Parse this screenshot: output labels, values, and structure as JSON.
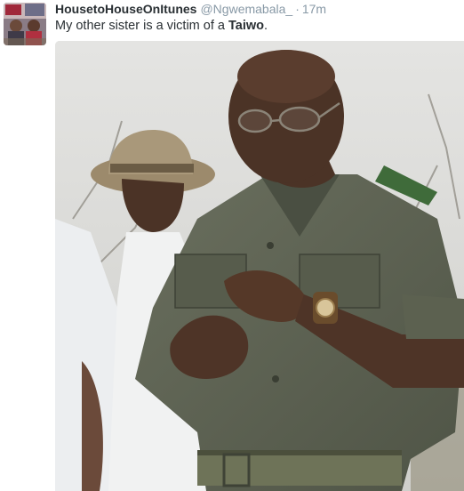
{
  "tweet": {
    "display_name": "HousetoHouseOnItunes",
    "handle": "@Ngwemabala_",
    "separator": "·",
    "time": "17m",
    "text_prefix": "My other sister is a victim of a ",
    "text_bold": "Taiwo",
    "text_suffix": "."
  },
  "avatar": {
    "icon": "profile-photo"
  },
  "media": {
    "icon": "photo-two-men-outdoors-in-bush"
  }
}
